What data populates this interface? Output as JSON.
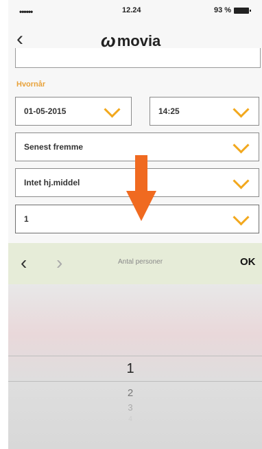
{
  "status_bar": {
    "signal": "••••••",
    "time": "12.24",
    "battery": "93 %"
  },
  "nav": {
    "back_icon": "chevron-left-icon",
    "logo_mark": "ω",
    "logo_text": "movia"
  },
  "form": {
    "section_label": "Hvornår",
    "date": "01-05-2015",
    "time": "14:25",
    "arrival_mode": "Senest fremme",
    "aid": "Intet hj.middel",
    "persons": "1"
  },
  "toolbar": {
    "prev": "‹",
    "next": "›",
    "title": "Antal personer",
    "ok": "OK"
  },
  "picker": {
    "options": [
      "1",
      "2",
      "3",
      "4"
    ],
    "selected": "1"
  },
  "colors": {
    "accent": "#f2a81d",
    "arrow": "#f06a20",
    "label": "#e8a23a"
  }
}
